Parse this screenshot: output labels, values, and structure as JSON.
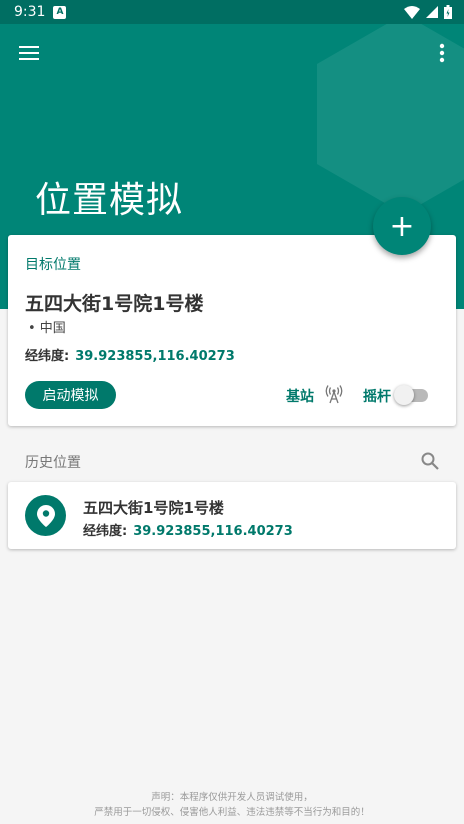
{
  "status_bar": {
    "time": "9:31",
    "notification_icon": "a-icon"
  },
  "toolbar": {
    "menu_icon": "menu-icon",
    "more_icon": "more-vert-icon"
  },
  "header": {
    "title": "位置模拟"
  },
  "fab": {
    "icon": "add-icon",
    "label": "+"
  },
  "target": {
    "label": "目标位置",
    "name": "五四大街1号院1号楼",
    "country": "• 中国",
    "coord_label": "经纬度:",
    "coord_value": "39.923855,116.40273",
    "start_button": "启动模拟",
    "base_station_label": "基站",
    "joystick_label": "摇杆",
    "joystick_enabled": false
  },
  "history": {
    "title": "历史位置",
    "items": [
      {
        "name": "五四大街1号院1号楼",
        "coord_label": "经纬度:",
        "coord_value": "39.923855,116.40273"
      }
    ]
  },
  "footer": {
    "line1": "声明：本程序仅供开发人员调试使用，",
    "line2": "严禁用于一切侵权、侵害他人利益、违法违禁等不当行为和目的！"
  },
  "colors": {
    "primary": "#008577",
    "primary_dark": "#006e62",
    "accent": "#00796b"
  }
}
